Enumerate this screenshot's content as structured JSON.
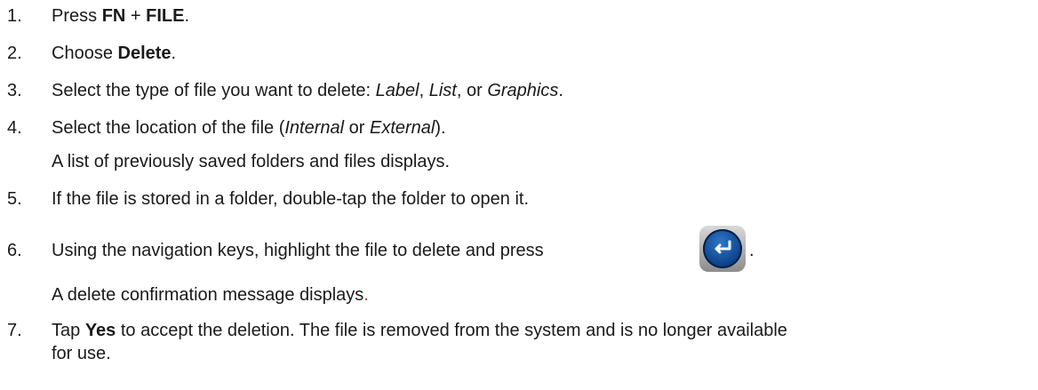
{
  "steps": [
    {
      "num": "1.",
      "pre": "Press ",
      "b1": "FN",
      "mid": " + ",
      "b2": "FILE",
      "post": "."
    },
    {
      "num": "2.",
      "pre": "Choose ",
      "b1": "Delete",
      "post": "."
    },
    {
      "num": "3.",
      "pre": "Select the type of file you want to delete: ",
      "i1": "Label",
      "s1": ", ",
      "i2": "List",
      "s2": ", or ",
      "i3": "Graphics",
      "post": "."
    },
    {
      "num": "4.",
      "pre": "Select the location of the file (",
      "i1": "Internal",
      "s1": " or ",
      "i2": "External",
      "post": ").",
      "sub": "A list of previously saved folders and files displays."
    },
    {
      "num": "5.",
      "text": "If the file is stored in a folder, double-tap the folder to open it."
    },
    {
      "num": "6.",
      "text": "Using the navigation keys, highlight the file to delete and press ",
      "post": ".",
      "sub": "A delete confirmation message displays",
      "sub_post": "."
    },
    {
      "num": "7.",
      "pre": "Tap ",
      "b1": "Yes",
      "post": " to accept the deletion. The file is removed from the system and is no longer available",
      "line2": "for use."
    }
  ],
  "icons": {
    "enter_key": "enter-key-icon"
  },
  "colors": {
    "text": "#1a1a1a",
    "accent_period": "#e02020",
    "key_blue": "#0b3f86"
  }
}
